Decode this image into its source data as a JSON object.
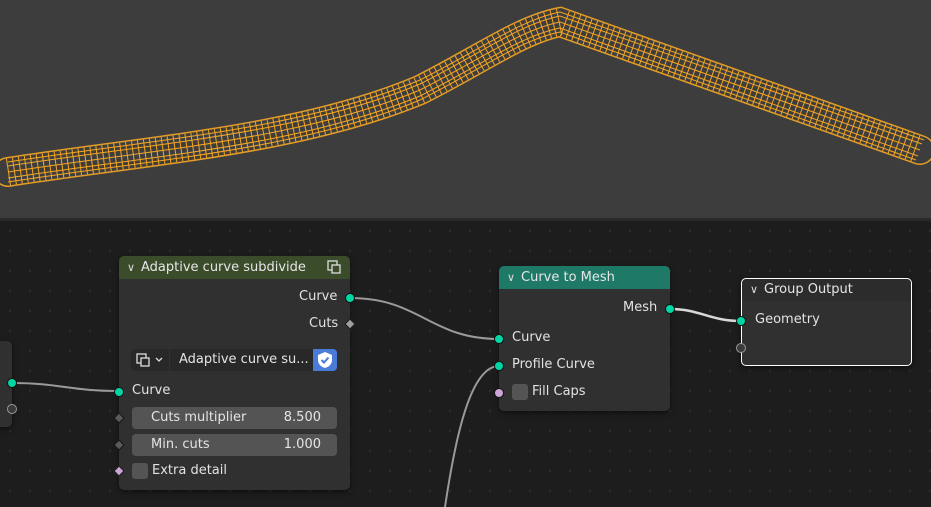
{
  "adaptive_node": {
    "title": "Adaptive curve subdivide",
    "out_curve": "Curve",
    "out_cuts": "Cuts",
    "group_select": "Adaptive curve su...",
    "in_curve": "Curve",
    "cuts_multiplier_label": "Cuts multiplier",
    "cuts_multiplier_value": "8.500",
    "min_cuts_label": "Min. cuts",
    "min_cuts_value": "1.000",
    "extra_detail_label": "Extra detail"
  },
  "curve_to_mesh_node": {
    "title": "Curve to Mesh",
    "out_mesh": "Mesh",
    "in_curve": "Curve",
    "in_profile": "Profile Curve",
    "fill_caps": "Fill Caps"
  },
  "group_output_node": {
    "title": "Group Output",
    "in_geometry": "Geometry"
  },
  "colors": {
    "viewport_bg": "#3d3d3d",
    "editor_bg": "#1d1d1d",
    "mesh_wire": "#f5a623",
    "geometry_socket": "#00d6a3",
    "adaptive_header": "#3b4c2b",
    "curve_to_mesh_header": "#1e7a66",
    "group_output_header": "#2c2c2c",
    "shield_icon": "#4a7bd8"
  }
}
